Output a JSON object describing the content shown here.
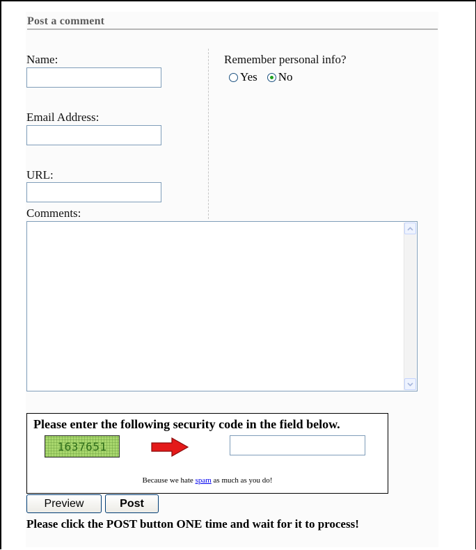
{
  "form": {
    "title": "Post a comment",
    "name_label": "Name:",
    "email_label": "Email Address:",
    "url_label": "URL:",
    "comments_label": "Comments:",
    "name_value": "",
    "email_value": "",
    "url_value": "",
    "comments_value": ""
  },
  "remember": {
    "label": "Remember personal info?",
    "options": [
      {
        "label": "Yes",
        "selected": false
      },
      {
        "label": "No",
        "selected": true
      }
    ]
  },
  "captcha": {
    "heading": "Please enter the following security code in the field below.",
    "code": "1637651",
    "input_value": "",
    "note_prefix": "Because we hate ",
    "note_link": "spam",
    "note_suffix": " as much as you do!"
  },
  "buttons": {
    "preview_label": "Preview",
    "post_label": "Post"
  },
  "post_note": "Please click the POST button ONE time and wait for it to process!",
  "colors": {
    "arrow": "#e41a1a",
    "captcha_bg": "#a9d86e",
    "input_border": "#7f9db9"
  }
}
